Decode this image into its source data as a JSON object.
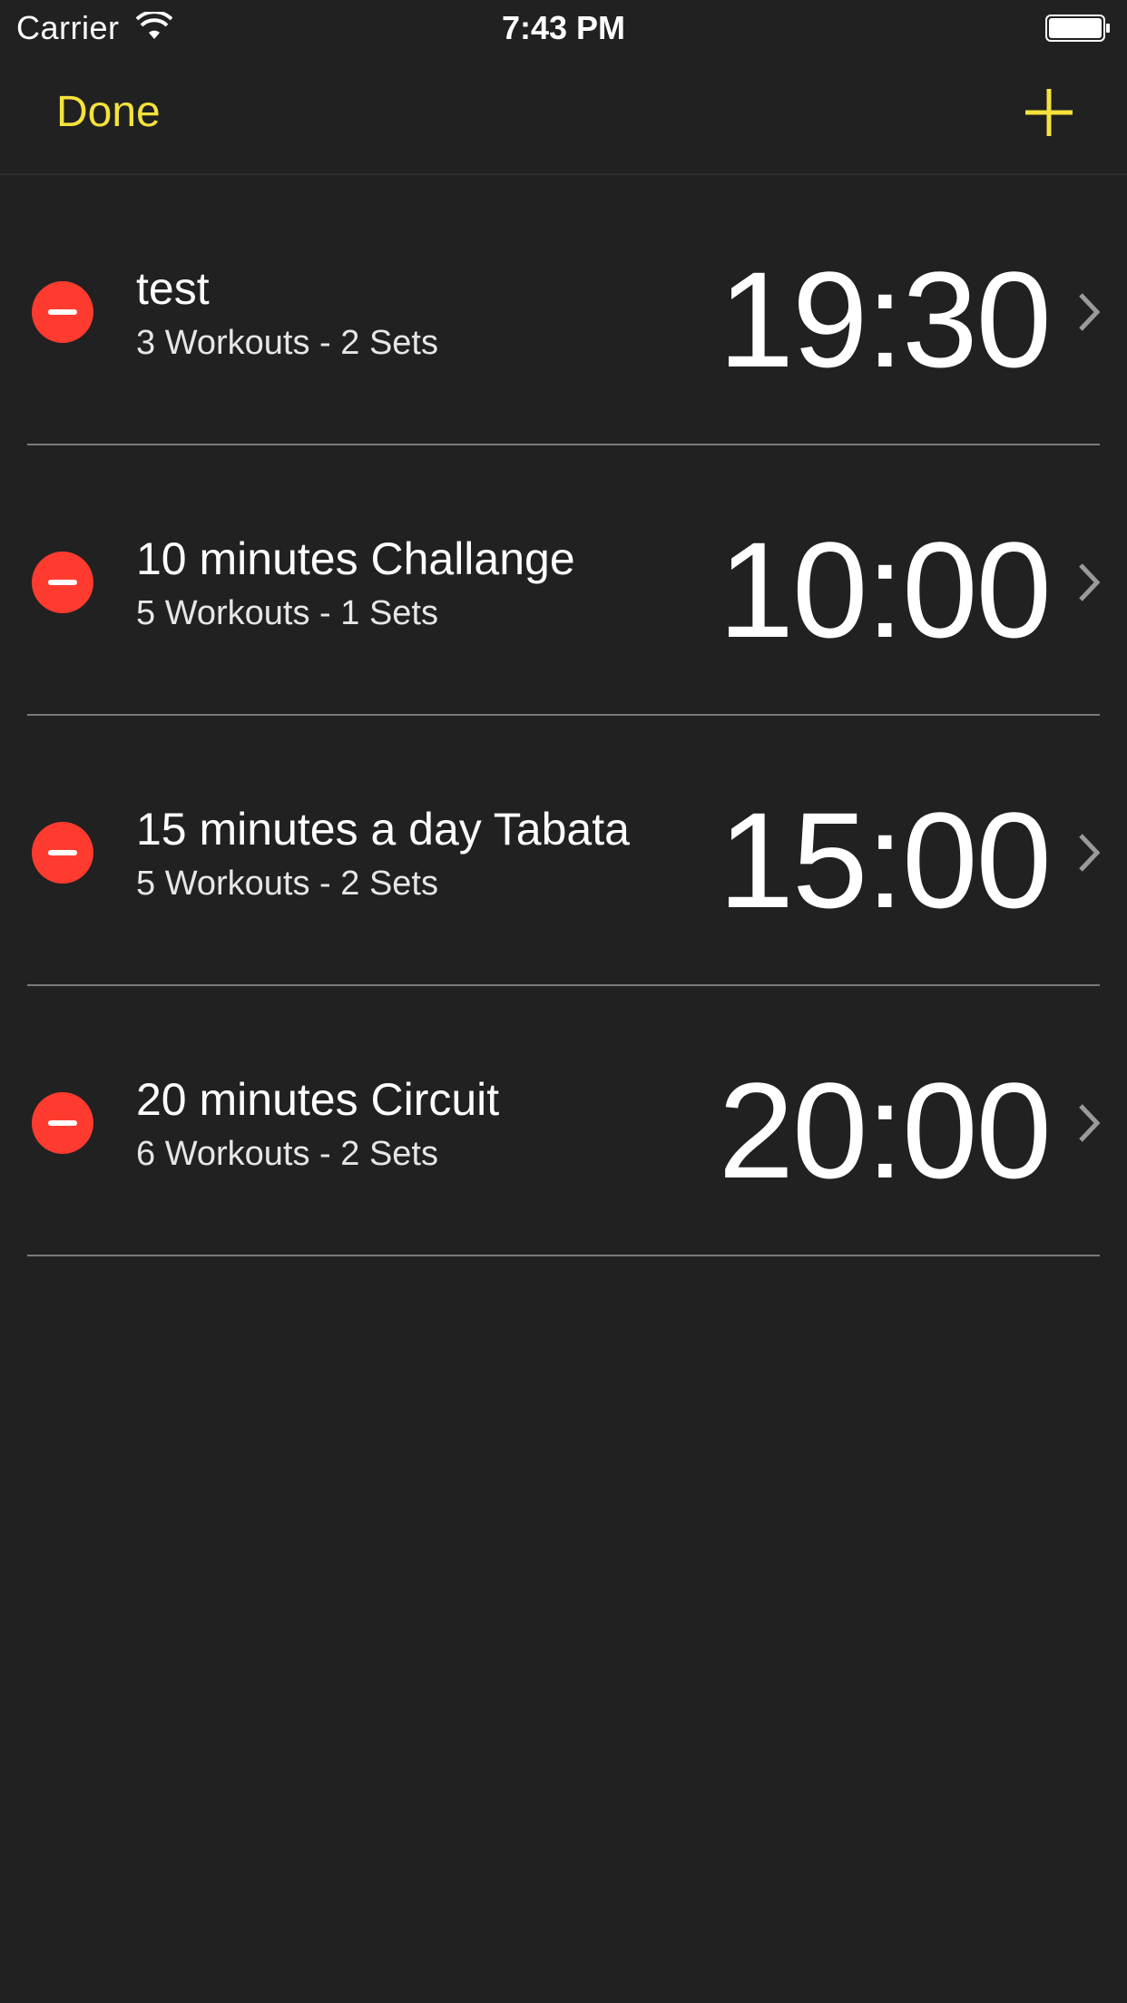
{
  "status_bar": {
    "carrier": "Carrier",
    "time": "7:43 PM",
    "icons": [
      "wifi-icon",
      "battery-icon"
    ]
  },
  "nav": {
    "done_label": "Done",
    "add_icon": "plus-icon",
    "accent_color": "#f5e23c"
  },
  "workouts": [
    {
      "title": "test",
      "subtitle": "3 Workouts - 2 Sets",
      "time": "19:30"
    },
    {
      "title": "10 minutes Challange",
      "subtitle": "5 Workouts - 1 Sets",
      "time": "10:00"
    },
    {
      "title": "15 minutes a day Tabata",
      "subtitle": "5 Workouts - 2 Sets",
      "time": "15:00"
    },
    {
      "title": "20 minutes Circuit",
      "subtitle": "6 Workouts - 2 Sets",
      "time": "20:00"
    }
  ],
  "colors": {
    "background": "#212121",
    "delete": "#ff3b30",
    "accent": "#f5e23c"
  }
}
